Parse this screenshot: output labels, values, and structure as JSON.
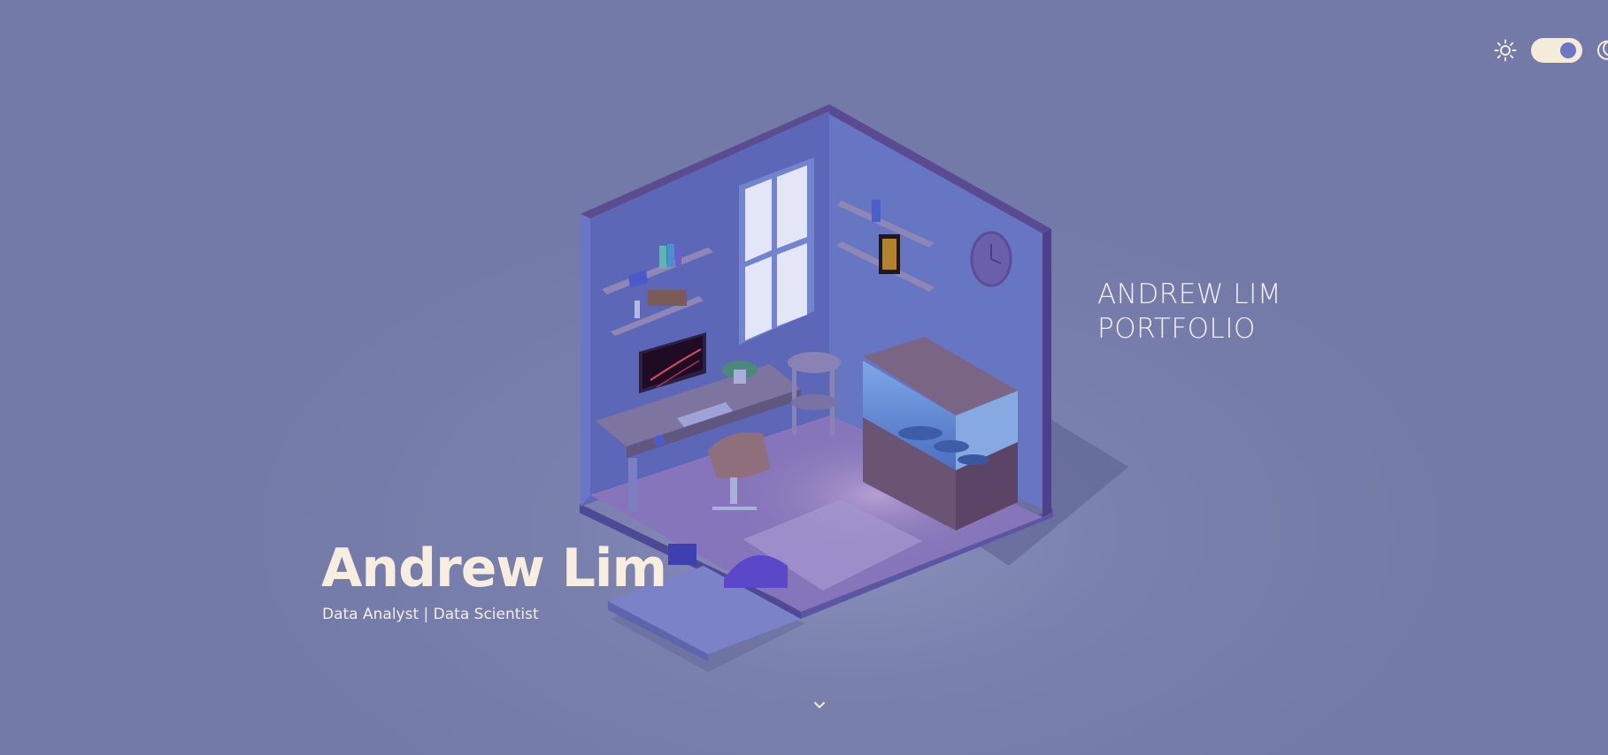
{
  "page": {
    "background": "#737aa7",
    "text_color": "#f8eee0"
  },
  "theme_toggle": {
    "light_icon": "sun-icon",
    "dark_icon": "moon-icon",
    "state": "dark",
    "track_color": "#f5ebd9",
    "knob_color": "#6d77c4"
  },
  "portfolio_title": {
    "line1": "ANDREW LIM",
    "line2": "PORTFOLIO"
  },
  "hero": {
    "name": "Andrew Lim",
    "subtitle": "Data Analyst | Data Scientist"
  },
  "scroll_indicator": {
    "icon": "chevron-down-icon"
  }
}
